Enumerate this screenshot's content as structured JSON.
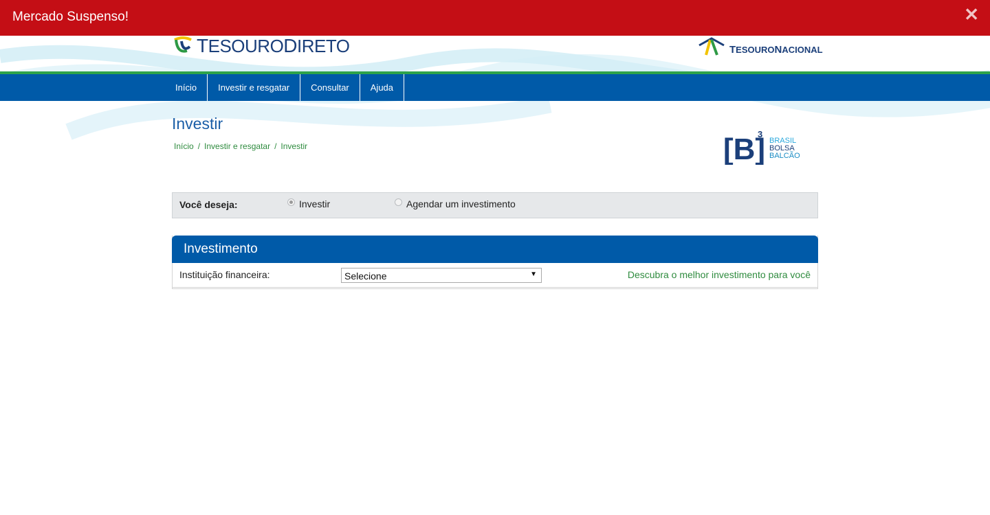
{
  "alert": {
    "text": "Mercado Suspenso!",
    "close_icon": "close-icon"
  },
  "header": {
    "logo_left": {
      "first": "T",
      "rest": "ESOURO",
      "first2": "D",
      "rest2": "IRETO"
    },
    "logo_right": {
      "first": "T",
      "rest": "ESOURO",
      "first2": "N",
      "rest2": "ACIONAL"
    }
  },
  "nav": {
    "items": [
      "Início",
      "Investir e resgatar",
      "Consultar",
      "Ajuda"
    ]
  },
  "page": {
    "title": "Investir",
    "breadcrumb": [
      "Início",
      "Investir e resgatar",
      "Investir"
    ],
    "breadcrumb_sep": "/"
  },
  "b3": {
    "mark": "[B]",
    "sup": "3",
    "line1": "BRASIL",
    "line2": "BOLSA",
    "line3": "BALCÃO"
  },
  "choice": {
    "label": "Você deseja:",
    "options": [
      "Investir",
      "Agendar um investimento"
    ],
    "selected": "Investir"
  },
  "panel": {
    "title": "Investimento",
    "field_label": "Instituição financeira:",
    "select_value": "Selecione",
    "select_arrow": "▼",
    "link": "Descubra o melhor investimento para você"
  },
  "colors": {
    "alert": "#c40e15",
    "nav": "#005aa8",
    "green": "#2e8b3e"
  }
}
